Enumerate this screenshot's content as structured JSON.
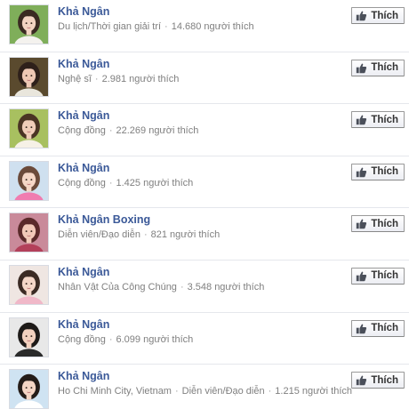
{
  "like_label": "Thích",
  "pages": [
    {
      "name": "Khả Ngân",
      "category": "Du lịch/Thời gian giải trí",
      "likes": "14.680 người thích",
      "avatar": {
        "bg": "#7fae5a",
        "hair": "#3a2a22",
        "skin": "#f2d3c2",
        "top": "#f4f2ee"
      }
    },
    {
      "name": "Khả Ngân",
      "category": "Nghệ sĩ",
      "likes": "2.981 người thích",
      "avatar": {
        "bg": "#5a4a2e",
        "hair": "#2e201a",
        "skin": "#eec8b4",
        "top": "#e9e6dc"
      }
    },
    {
      "name": "Khả Ngân",
      "category": "Cộng đồng",
      "likes": "22.269 người thích",
      "avatar": {
        "bg": "#a8c060",
        "hair": "#4a3424",
        "skin": "#f0cdb9",
        "top": "#f6f1e6"
      }
    },
    {
      "name": "Khả Ngân",
      "category": "Cộng đồng",
      "likes": "1.425 người thích",
      "avatar": {
        "bg": "#cfe0ef",
        "hair": "#6b4a3a",
        "skin": "#f5d6c6",
        "top": "#f07cb0"
      }
    },
    {
      "name": "Khả Ngân Boxing",
      "category": "Diễn viên/Đạo diễn",
      "likes": "821 người thích",
      "avatar": {
        "bg": "#c98a9a",
        "hair": "#5a2a2a",
        "skin": "#f1c9b8",
        "top": "#b3405a"
      }
    },
    {
      "name": "Khả Ngân",
      "category": "Nhân Vật Của Công Chúng",
      "likes": "3.548 người thích",
      "avatar": {
        "bg": "#efe6e2",
        "hair": "#3b2b24",
        "skin": "#f4d7c8",
        "top": "#f0b8c8"
      }
    },
    {
      "name": "Khả Ngân",
      "category": "Cộng đồng",
      "likes": "6.099 người thích",
      "avatar": {
        "bg": "#e8e8e8",
        "hair": "#1e1a18",
        "skin": "#f2d0be",
        "top": "#2a2a2a"
      }
    },
    {
      "name": "Khả Ngân",
      "category": "Ho Chi Minh City, Vietnam",
      "category2": "Diễn viên/Đạo diễn",
      "likes": "1.215 người thích",
      "avatar": {
        "bg": "#cfe3f2",
        "hair": "#241c18",
        "skin": "#f4d5c4",
        "top": "#ffffff"
      }
    }
  ]
}
